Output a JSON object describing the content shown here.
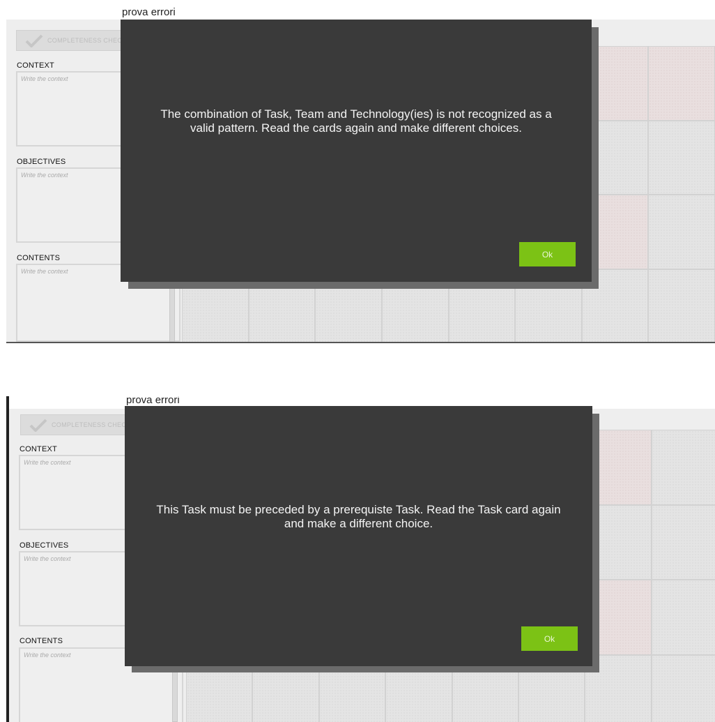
{
  "screens": [
    {
      "title": "prova errori",
      "completeness_label": "COMPLETENESS CHECK",
      "sections": [
        {
          "label": "CONTEXT",
          "placeholder": "Write the context"
        },
        {
          "label": "OBJECTIVES",
          "placeholder": "Write the context"
        },
        {
          "label": "CONTENTS",
          "placeholder": "Write the context"
        }
      ],
      "dialog": {
        "message": "The combination of Task, Team and Technology(ies) is not recognized as a valid pattern. Read the cards again and make different choices.",
        "ok_label": "Ok"
      }
    },
    {
      "title": "prova errori",
      "completeness_label": "COMPLETENESS CHECK",
      "sections": [
        {
          "label": "CONTEXT",
          "placeholder": "Write the context"
        },
        {
          "label": "OBJECTIVES",
          "placeholder": "Write the context"
        },
        {
          "label": "CONTENTS",
          "placeholder": "Write the context"
        }
      ],
      "dialog": {
        "message": "This Task must be preceded by a prerequiste Task. Read the Task card again and make a different choice.",
        "ok_label": "Ok"
      }
    }
  ],
  "colors": {
    "dialog_bg": "#3a3a3a",
    "ok_button": "#7cc215",
    "panel_bg": "#eeeeee"
  },
  "icons": {
    "completeness": "check-icon"
  }
}
